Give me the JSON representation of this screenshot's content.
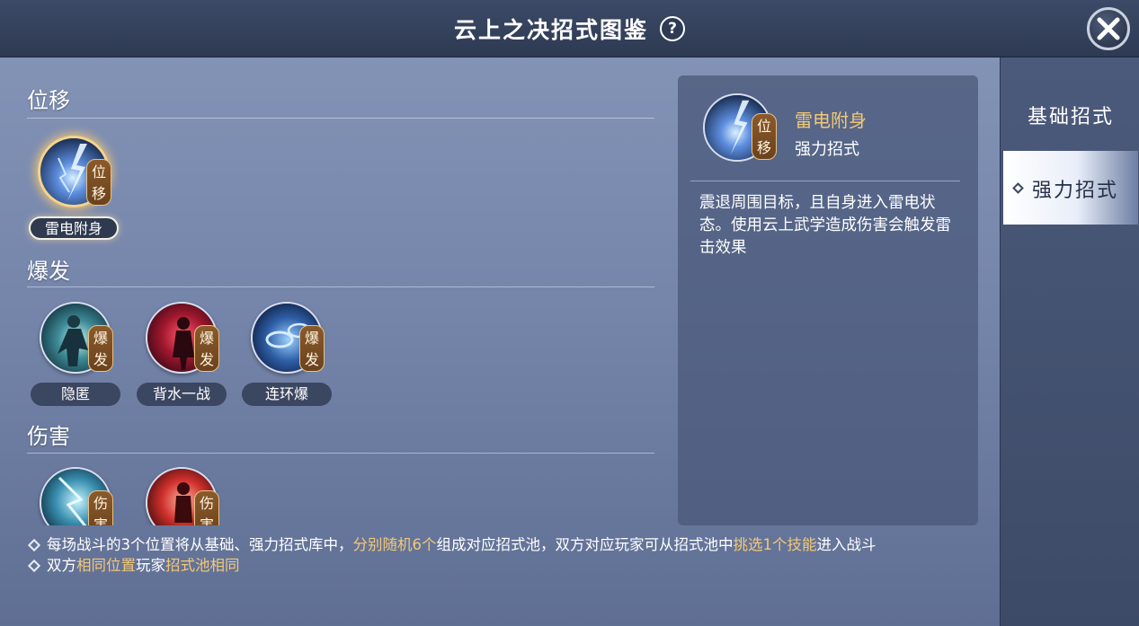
{
  "header": {
    "title": "云上之决招式图鉴",
    "help_label": "?"
  },
  "sections": [
    {
      "title": "位移",
      "skills": [
        {
          "name": "雷电附身",
          "tag": "位移",
          "selected": true
        }
      ]
    },
    {
      "title": "爆发",
      "skills": [
        {
          "name": "隐匿",
          "tag": "爆发"
        },
        {
          "name": "背水一战",
          "tag": "爆发"
        },
        {
          "name": "连环爆",
          "tag": "爆发"
        }
      ]
    },
    {
      "title": "伤害",
      "skills": [
        {
          "name": "",
          "tag": "伤害"
        },
        {
          "name": "",
          "tag": "伤害"
        }
      ]
    }
  ],
  "detail": {
    "name": "雷电附身",
    "type": "强力招式",
    "tag": "位移",
    "description": "震退周围目标，且自身进入雷电状态。使用云上武学造成伤害会触发雷击效果"
  },
  "notes": [
    {
      "parts": [
        {
          "text": "每场战斗的3个位置将从基础、强力招式库中，",
          "highlight": false
        },
        {
          "text": "分别随机6个",
          "highlight": true
        },
        {
          "text": "组成对应招式池，双方对应玩家可从招式池中",
          "highlight": false
        },
        {
          "text": "挑选1个技能",
          "highlight": true
        },
        {
          "text": "进入战斗",
          "highlight": false
        }
      ]
    },
    {
      "parts": [
        {
          "text": "双方",
          "highlight": false
        },
        {
          "text": "相同位置",
          "highlight": true
        },
        {
          "text": "玩家",
          "highlight": false
        },
        {
          "text": "招式池相同",
          "highlight": true
        }
      ]
    }
  ],
  "tabs": [
    {
      "label": "基础招式",
      "active": false
    },
    {
      "label": "强力招式",
      "active": true
    }
  ],
  "colors": {
    "highlight": "#f3c877",
    "panel": "#7585aa",
    "tab_active": "#ffffff"
  }
}
